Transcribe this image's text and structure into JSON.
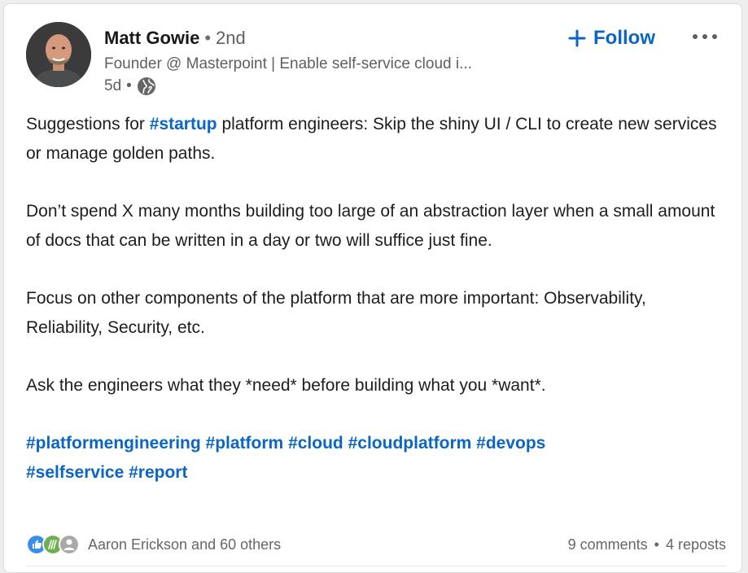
{
  "author": {
    "name": "Matt Gowie",
    "degree": "2nd",
    "headline": "Founder @ Masterpoint | Enable self-service cloud i...",
    "time": "5d",
    "visibility_icon": "globe-icon"
  },
  "actions": {
    "follow_label": "Follow",
    "follow_icon": "plus-icon",
    "more_icon": "ellipsis-icon"
  },
  "post": {
    "p1_before": "Suggestions for ",
    "p1_tag": "#startup",
    "p1_after": " platform engineers: Skip the shiny UI / CLI to create new services or manage golden paths.",
    "p2": "Don’t spend X many months building too large of an abstraction layer when a small amount of docs that can be written in a day or two will suffice just fine.",
    "p3": "Focus on other components of the platform that are more important: Observability, Reliability, Security, etc.",
    "p4": "Ask the engineers what they *need* before building what you *want*.",
    "hashtags": [
      "#platformengineering",
      "#platform",
      "#cloud",
      "#cloudplatform",
      "#devops",
      "#selfservice",
      "#report"
    ]
  },
  "social": {
    "reaction_icons": [
      "like-icon",
      "celebrate-icon",
      "support-icon"
    ],
    "reactions_text": "Aaron Erickson and 60 others",
    "comments": "9 comments",
    "reposts": "4 reposts"
  },
  "colors": {
    "accent": "#0a66c2",
    "secondary_text": "#5f5f5f",
    "like": "#378fe9",
    "celebrate": "#6dae4f"
  }
}
